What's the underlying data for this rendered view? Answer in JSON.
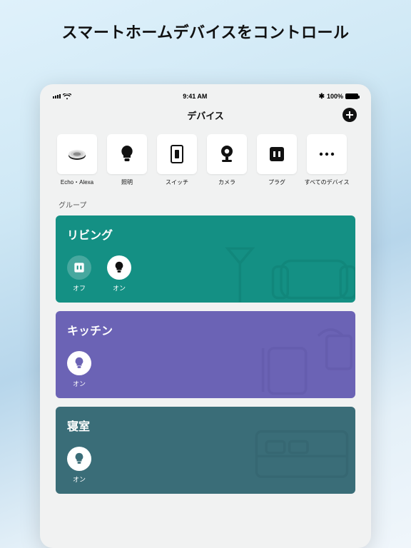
{
  "hero_title": "スマートホームデバイスをコントロール",
  "statusbar": {
    "time": "9:41 AM",
    "bt_label": "100%",
    "bt_icon": "*"
  },
  "nav": {
    "title": "デバイス"
  },
  "categories": [
    {
      "id": "echo",
      "label": "Echo・Alexa"
    },
    {
      "id": "light",
      "label": "照明"
    },
    {
      "id": "switch",
      "label": "スイッチ"
    },
    {
      "id": "camera",
      "label": "カメラ"
    },
    {
      "id": "plug",
      "label": "プラグ"
    },
    {
      "id": "all",
      "label": "すべてのデバイス"
    }
  ],
  "section_groups_label": "グループ",
  "groups": [
    {
      "id": "living",
      "title": "リビング",
      "color": "#149084",
      "devices": [
        {
          "type": "plug",
          "state": "off",
          "label": "オフ"
        },
        {
          "type": "bulb",
          "state": "on",
          "label": "オン"
        }
      ]
    },
    {
      "id": "kitchen",
      "title": "キッチン",
      "color": "#6b63b5",
      "devices": [
        {
          "type": "bulb",
          "state": "on",
          "label": "オン"
        }
      ]
    },
    {
      "id": "bedroom",
      "title": "寝室",
      "color": "#3a6d78",
      "devices": [
        {
          "type": "bulb",
          "state": "on",
          "label": "オン"
        }
      ]
    }
  ]
}
